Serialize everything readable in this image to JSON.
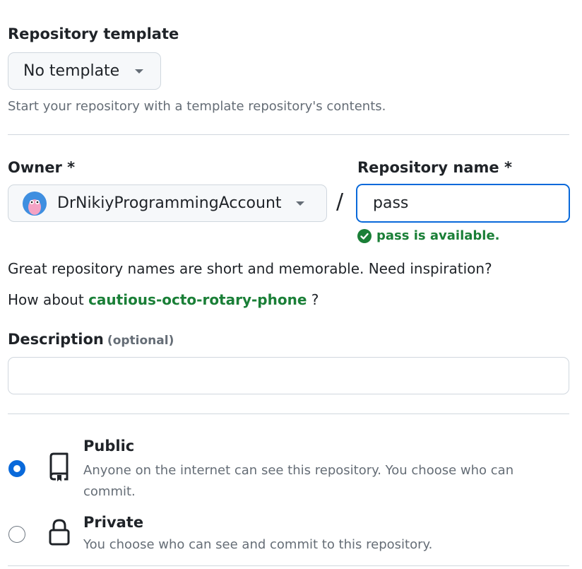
{
  "template": {
    "label": "Repository template",
    "selected": "No template",
    "hint": "Start your repository with a template repository's contents."
  },
  "owner": {
    "label": "Owner *",
    "selected": "DrNikiyProgrammingAccount"
  },
  "separator": "/",
  "repo_name": {
    "label": "Repository name *",
    "value": "pass",
    "availability": "pass is available."
  },
  "suggestion": {
    "intro": "Great repository names are short and memorable. Need inspiration?",
    "how_about": "How about",
    "name": "cautious-octo-rotary-phone",
    "suffix": "?"
  },
  "description": {
    "label": "Description",
    "optional": "(optional)",
    "value": ""
  },
  "visibility": {
    "public": {
      "label": "Public",
      "desc": "Anyone on the internet can see this repository. You choose who can commit.",
      "selected": true
    },
    "private": {
      "label": "Private",
      "desc": "You choose who can see and commit to this repository.",
      "selected": false
    }
  },
  "colors": {
    "accent_blue": "#0969da",
    "success_green": "#1a7f37",
    "border": "#d0d7de"
  }
}
